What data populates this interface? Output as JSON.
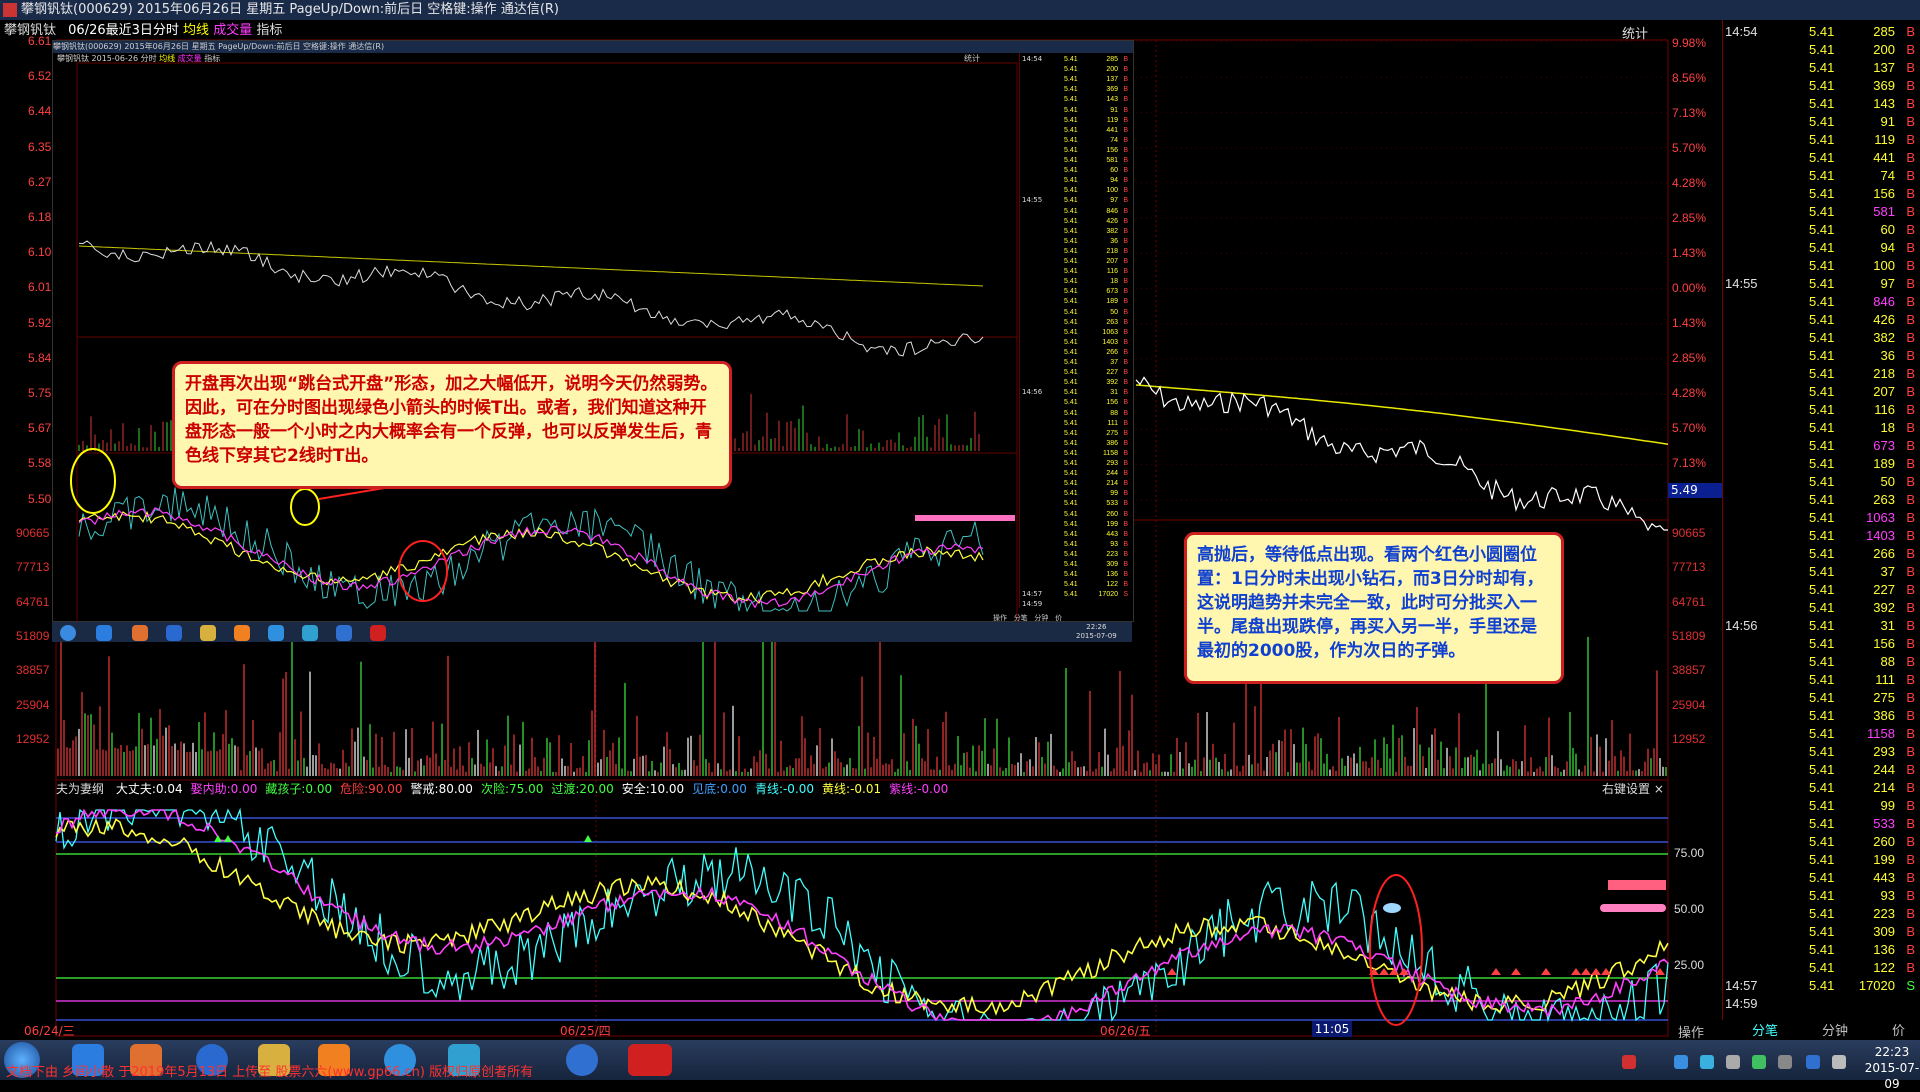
{
  "window": {
    "title": "攀钢钒钛(000629) 2015年06月26日 星期五 PageUp/Down:前后日 空格键:操作 通达信(R)"
  },
  "chart_header": {
    "stock": "攀钢钒钛",
    "period": "06/26最近3日分时",
    "avg_label": "均线",
    "vol_label": "成交量",
    "indicator": "指标",
    "stat": "统计"
  },
  "price_axis_left": [
    "6.61",
    "6.52",
    "6.44",
    "6.35",
    "6.27",
    "6.18",
    "6.10",
    "6.01",
    "5.92",
    "5.84",
    "5.75",
    "5.67",
    "5.58",
    "5.50"
  ],
  "price_axis_right": [
    "9.98%",
    "8.56%",
    "7.13%",
    "5.70%",
    "4.28%",
    "2.85%",
    "1.43%",
    "0.00%",
    "1.43%",
    "2.85%",
    "4.28%",
    "5.70%",
    "7.13%"
  ],
  "volume_axis": [
    "90665",
    "77713",
    "64761",
    "51809",
    "38857",
    "25904",
    "12952"
  ],
  "indicator_header": {
    "name": "夫为妻纲",
    "items": [
      {
        "label": "大丈夫:",
        "value": "0.04",
        "color": "#ffffff"
      },
      {
        "label": "娶内助:",
        "value": "0.00",
        "color": "#ff40ff"
      },
      {
        "label": "藏孩子:",
        "value": "0.00",
        "color": "#40ff40"
      },
      {
        "label": "危险:",
        "value": "90.00",
        "color": "#ff4040"
      },
      {
        "label": "警戒:",
        "value": "80.00",
        "color": "#ffffff"
      },
      {
        "label": "次险:",
        "value": "75.00",
        "color": "#40ff40"
      },
      {
        "label": "过渡:",
        "value": "20.00",
        "color": "#40ff40"
      },
      {
        "label": "安全:",
        "value": "10.00",
        "color": "#ffffff"
      },
      {
        "label": "见底:",
        "value": "0.00",
        "color": "#40a0ff"
      },
      {
        "label": "青线:",
        "value": "-0.00",
        "color": "#40ffff"
      },
      {
        "label": "黄线:",
        "value": "-0.01",
        "color": "#ffff40"
      },
      {
        "label": "紫线:",
        "value": "-0.00",
        "color": "#ff40ff"
      }
    ],
    "right_settings": "右键设置"
  },
  "indicator_axis": [
    "75.00",
    "50.00",
    "25.00"
  ],
  "x_axis": {
    "dates": [
      "06/24/三",
      "06/25/四",
      "06/26/五"
    ],
    "cursor_time": "11:05"
  },
  "cursor_price": "5.49",
  "ticker": {
    "time_labels": [
      {
        "row": 0,
        "time": "14:54"
      },
      {
        "row": 14,
        "time": "14:55"
      },
      {
        "row": 33,
        "time": "14:56"
      },
      {
        "row": 53,
        "time": "14:57"
      },
      {
        "row": 54,
        "time": "14:59"
      }
    ],
    "price": "5.41",
    "rows": [
      {
        "v": "285",
        "s": "B"
      },
      {
        "v": "200",
        "s": "B"
      },
      {
        "v": "137",
        "s": "B"
      },
      {
        "v": "369",
        "s": "B"
      },
      {
        "v": "143",
        "s": "B"
      },
      {
        "v": "91",
        "s": "B"
      },
      {
        "v": "119",
        "s": "B"
      },
      {
        "v": "441",
        "s": "B"
      },
      {
        "v": "74",
        "s": "B"
      },
      {
        "v": "156",
        "s": "B"
      },
      {
        "v": "581",
        "s": "B",
        "pink": true
      },
      {
        "v": "60",
        "s": "B"
      },
      {
        "v": "94",
        "s": "B"
      },
      {
        "v": "100",
        "s": "B"
      },
      {
        "v": "97",
        "s": "B"
      },
      {
        "v": "846",
        "s": "B",
        "pink": true
      },
      {
        "v": "426",
        "s": "B"
      },
      {
        "v": "382",
        "s": "B"
      },
      {
        "v": "36",
        "s": "B"
      },
      {
        "v": "218",
        "s": "B"
      },
      {
        "v": "207",
        "s": "B"
      },
      {
        "v": "116",
        "s": "B"
      },
      {
        "v": "18",
        "s": "B"
      },
      {
        "v": "673",
        "s": "B",
        "pink": true
      },
      {
        "v": "189",
        "s": "B"
      },
      {
        "v": "50",
        "s": "B"
      },
      {
        "v": "263",
        "s": "B"
      },
      {
        "v": "1063",
        "s": "B",
        "pink": true
      },
      {
        "v": "1403",
        "s": "B",
        "pink": true
      },
      {
        "v": "266",
        "s": "B"
      },
      {
        "v": "37",
        "s": "B"
      },
      {
        "v": "227",
        "s": "B"
      },
      {
        "v": "392",
        "s": "B"
      },
      {
        "v": "31",
        "s": "B"
      },
      {
        "v": "156",
        "s": "B"
      },
      {
        "v": "88",
        "s": "B"
      },
      {
        "v": "111",
        "s": "B"
      },
      {
        "v": "275",
        "s": "B"
      },
      {
        "v": "386",
        "s": "B"
      },
      {
        "v": "1158",
        "s": "B",
        "pink": true
      },
      {
        "v": "293",
        "s": "B"
      },
      {
        "v": "244",
        "s": "B"
      },
      {
        "v": "214",
        "s": "B"
      },
      {
        "v": "99",
        "s": "B"
      },
      {
        "v": "533",
        "s": "B",
        "pink": true
      },
      {
        "v": "260",
        "s": "B"
      },
      {
        "v": "199",
        "s": "B"
      },
      {
        "v": "443",
        "s": "B"
      },
      {
        "v": "93",
        "s": "B"
      },
      {
        "v": "223",
        "s": "B"
      },
      {
        "v": "309",
        "s": "B"
      },
      {
        "v": "136",
        "s": "B"
      },
      {
        "v": "122",
        "s": "B"
      },
      {
        "v": "17020",
        "s": "S"
      }
    ],
    "tabs": [
      "分笔",
      "分钟",
      "价"
    ],
    "ops": "操作"
  },
  "callouts": {
    "left": "开盘再次出现“跳台式开盘”形态，加之大幅低开，说明今天仍然弱势。因此，可在分时图出现绿色小箭头的时候T出。或者，我们知道这种开盘形态一般一个小时之内大概率会有一个反弹，也可以反弹发生后，青色线下穿其它2线时T出。",
    "right": "高抛后，等待低点出现。看两个红色小圆圈位置：1日分时未出现小钻石，而3日分时却有，这说明趋势并未完全一致，此时可分批买入一半。尾盘出现跌停，再买入另一半，手里还是最初的2000股，作为次日的子弹。"
  },
  "inset": {
    "title": "攀钢钒钛(000629) 2015年06月26日 星期五 PageUp/Down:前后日 空格键:操作 通达信(R)",
    "info": "攀钢钒钛 2015-06-26 分时",
    "avg_label": "均线",
    "vol_label": "成交量",
    "indicator": "指标",
    "stat": "统计",
    "times": [
      "14:54",
      "14:55",
      "14:56",
      "14:57",
      "14:59"
    ],
    "ops_labels": [
      "操作",
      "分笔",
      "分钟",
      "价"
    ],
    "clock": {
      "time": "22:26",
      "date": "2015-07-09"
    }
  },
  "taskbar": {
    "clock_time": "22:23",
    "clock_date": "2015-07-09",
    "watermark": "文档下由 乡间小散 于2019年5月13日 上传至 股票六六(www.gp66.cn) 版权归原创者所有"
  },
  "colors": {
    "price_line": "#ffffff",
    "avg_line": "#e8e800",
    "volume_bar": "#e0e0e0",
    "ind_cyan": "#40ffff",
    "ind_yellow": "#ffff40",
    "ind_magenta": "#ff40ff",
    "axis_red": "#ff4040",
    "grid_red": "#700000"
  }
}
